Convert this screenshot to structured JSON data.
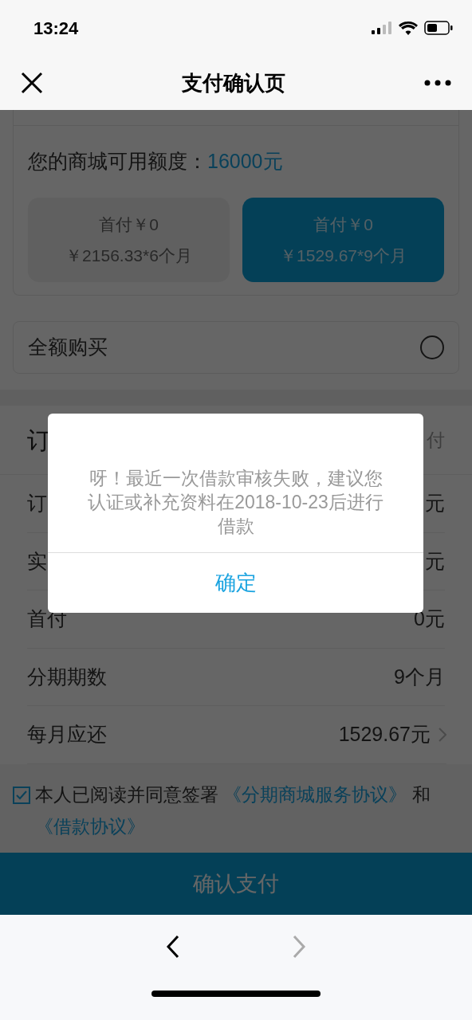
{
  "status_bar": {
    "time": "13:24"
  },
  "nav": {
    "title": "支付确认页"
  },
  "credit": {
    "label": "您的商城可用额度：",
    "amount": "16000元"
  },
  "plans": [
    {
      "down_payment": "首付￥0",
      "installment": "￥2156.33*6个月",
      "selected": false
    },
    {
      "down_payment": "首付￥0",
      "installment": "￥1529.67*9个月",
      "selected": true
    }
  ],
  "full_payment": {
    "label": "全额购买",
    "selected": false
  },
  "order_rows": [
    {
      "kind": "header",
      "label": "订",
      "value": "付"
    },
    {
      "kind": "row",
      "label": "订",
      "value": "元"
    },
    {
      "kind": "row",
      "label": "实",
      "value": "元"
    },
    {
      "kind": "row",
      "label": "首付",
      "value": "0元"
    },
    {
      "kind": "row",
      "label": "分期期数",
      "value": "9个月"
    },
    {
      "kind": "link",
      "label": "每月应还",
      "value": "1529.67元"
    }
  ],
  "agreement": {
    "checked": true,
    "parts": [
      {
        "kind": "text",
        "text": "本人已阅读并同意签署 "
      },
      {
        "kind": "link",
        "text": "《分期商城服务协议》"
      },
      {
        "kind": "text",
        "text": " 和"
      },
      {
        "kind": "link",
        "text": "《借款协议》"
      }
    ]
  },
  "confirm_button": "确认支付",
  "dialog": {
    "message": "呀！最近一次借款审核失败，建议您认证或补充资料在2018-10-23后进行借款",
    "button": "确定"
  },
  "browser_toolbar": {
    "back_enabled": true,
    "forward_enabled": false
  }
}
